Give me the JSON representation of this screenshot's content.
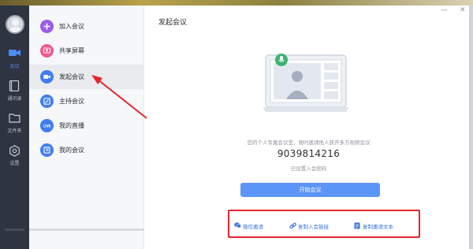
{
  "rail": {
    "items": [
      {
        "label": "会议",
        "icon": "video-camera-icon",
        "active": true
      },
      {
        "label": "通讯录",
        "icon": "contacts-book-icon",
        "active": false
      },
      {
        "label": "文件夹",
        "icon": "folder-icon",
        "active": false
      },
      {
        "label": "设置",
        "icon": "gear-icon",
        "active": false
      }
    ]
  },
  "menu": {
    "items": [
      {
        "label": "加入会议",
        "icon": "plus-icon",
        "color": "#9c5ae8"
      },
      {
        "label": "共享屏幕",
        "icon": "share-screen-icon",
        "color": "#f05a8c"
      },
      {
        "label": "发起会议",
        "icon": "video-icon",
        "color": "#3f7ef2"
      },
      {
        "label": "主持会议",
        "icon": "host-icon",
        "color": "#3f7ef2"
      },
      {
        "label": "我的直播",
        "icon": "live-icon",
        "color": "#3f7ef2"
      },
      {
        "label": "我的会议",
        "icon": "meeting-list-icon",
        "color": "#3f7ef2"
      }
    ]
  },
  "main": {
    "title": "发起会议",
    "description": "您的个人专属会议室，随时邀请他人获开多方视频会议",
    "meeting_id": "9039814216",
    "password_status": "已设置入会密码",
    "start_button": "开始会议"
  },
  "share": {
    "items": [
      {
        "label": "微信邀请",
        "icon": "wechat-icon"
      },
      {
        "label": "复制入会链接",
        "icon": "link-icon"
      },
      {
        "label": "复制邀请文本",
        "icon": "document-icon"
      }
    ]
  },
  "window": {
    "minimize": "—",
    "close": "✕"
  },
  "colors": {
    "rail_bg": "#2f3441",
    "accent": "#5b95f7",
    "link": "#3a74e0",
    "annotation": "#e4262c"
  }
}
